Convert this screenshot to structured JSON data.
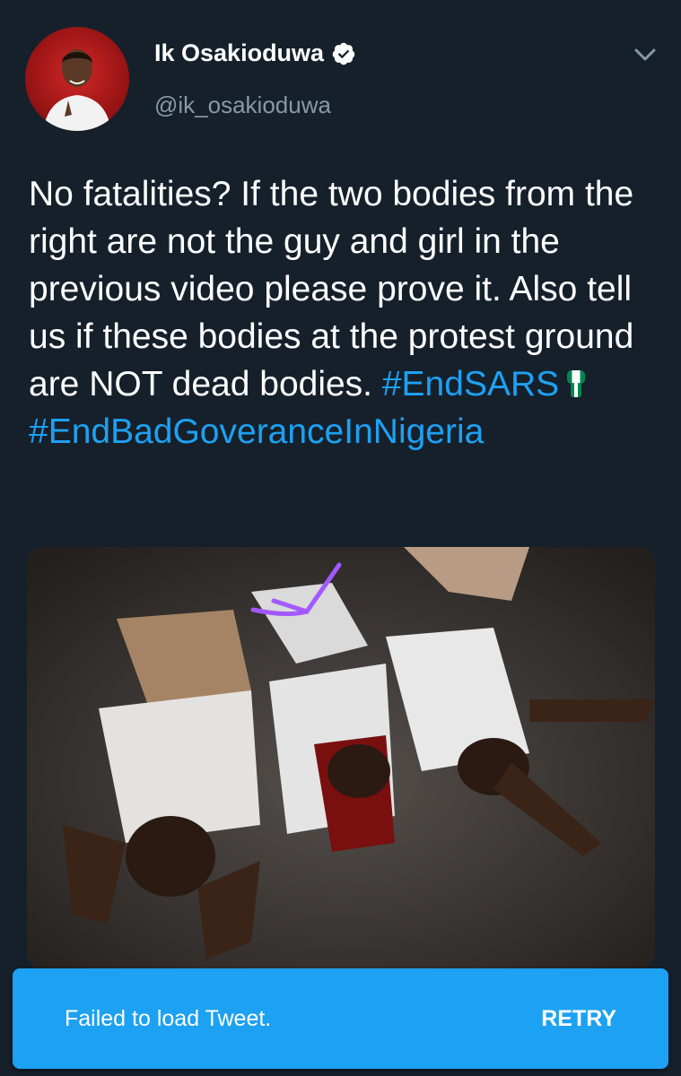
{
  "author": {
    "name": "Ik Osakioduwa",
    "handle": "@ik_osakioduwa",
    "verified": true
  },
  "tweet": {
    "text_plain": "No fatalities? If the two bodies from the right are not the guy and girl in the previous video please prove it. Also tell us if these bodies at the protest ground  are NOT dead bodies.",
    "hashtag_1": "#EndSARS",
    "hashtag_2": "#EndBadGoveranceInNigeria"
  },
  "toast": {
    "message": "Failed to load Tweet.",
    "action_label": "RETRY"
  },
  "icons": {
    "verified": "verified-badge-icon",
    "menu": "chevron-down-icon",
    "emoji": "raised-fist-icon"
  },
  "colors": {
    "background": "#15202b",
    "accent": "#1da1f2",
    "secondary_text": "#8899a6"
  }
}
